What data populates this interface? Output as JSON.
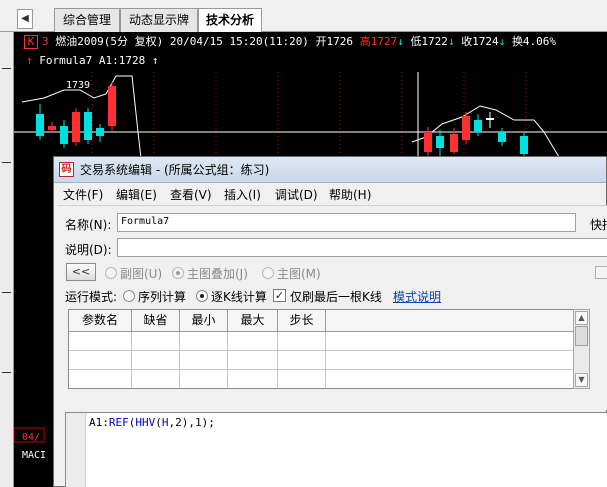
{
  "tabs": [
    "综合管理",
    "动态显示牌",
    "技术分析"
  ],
  "chart": {
    "k_label": "K",
    "num": "3",
    "symbol": "燃油2009(5分 复权)",
    "datetime": "20/04/15 15:20(11:20)",
    "open": "开1726",
    "high": "高1727",
    "low": "低1722",
    "close": "收1724",
    "turnover": "换4.06%",
    "formula_line": "Formula7 A1:1728",
    "peak_label": "1739",
    "bottom_date": "04/",
    "bottom_indicator": "MACI",
    "colors": {
      "up": "#ff3030",
      "down": "#00e0e0",
      "line": "#ffffff"
    }
  },
  "dialog": {
    "title": "交易系统编辑 - (所属公式组：练习)",
    "menu": [
      "文件(F)",
      "编辑(E)",
      "查看(V)",
      "插入(I)",
      "调试(D)",
      "帮助(H)"
    ],
    "name_label": "名称(N):",
    "name_value": "Formula7",
    "right_cut": "快拍",
    "desc_label": "说明(D):",
    "desc_value": "",
    "back_button": "<<",
    "chart_type_options": [
      "副图(U)",
      "主图叠加(J)",
      "主图(M)"
    ],
    "chart_type_selected": "主图叠加(J)",
    "run_mode_label": "运行模式:",
    "run_mode_options": [
      "序列计算",
      "逐K线计算"
    ],
    "run_mode_selected": "逐K线计算",
    "refresh_last_label": "仅刷最后一根K线",
    "refresh_last_checked": true,
    "mode_help_link": "模式说明",
    "param_headers": [
      "参数名",
      "缺省",
      "最小",
      "最大",
      "步长"
    ],
    "code_prefix": "A1:",
    "code_fn1": "REF",
    "code_mid1": "(",
    "code_fn2": "HHV",
    "code_mid2": "(",
    "code_arg": "H",
    "code_tail": ",2),1);"
  }
}
